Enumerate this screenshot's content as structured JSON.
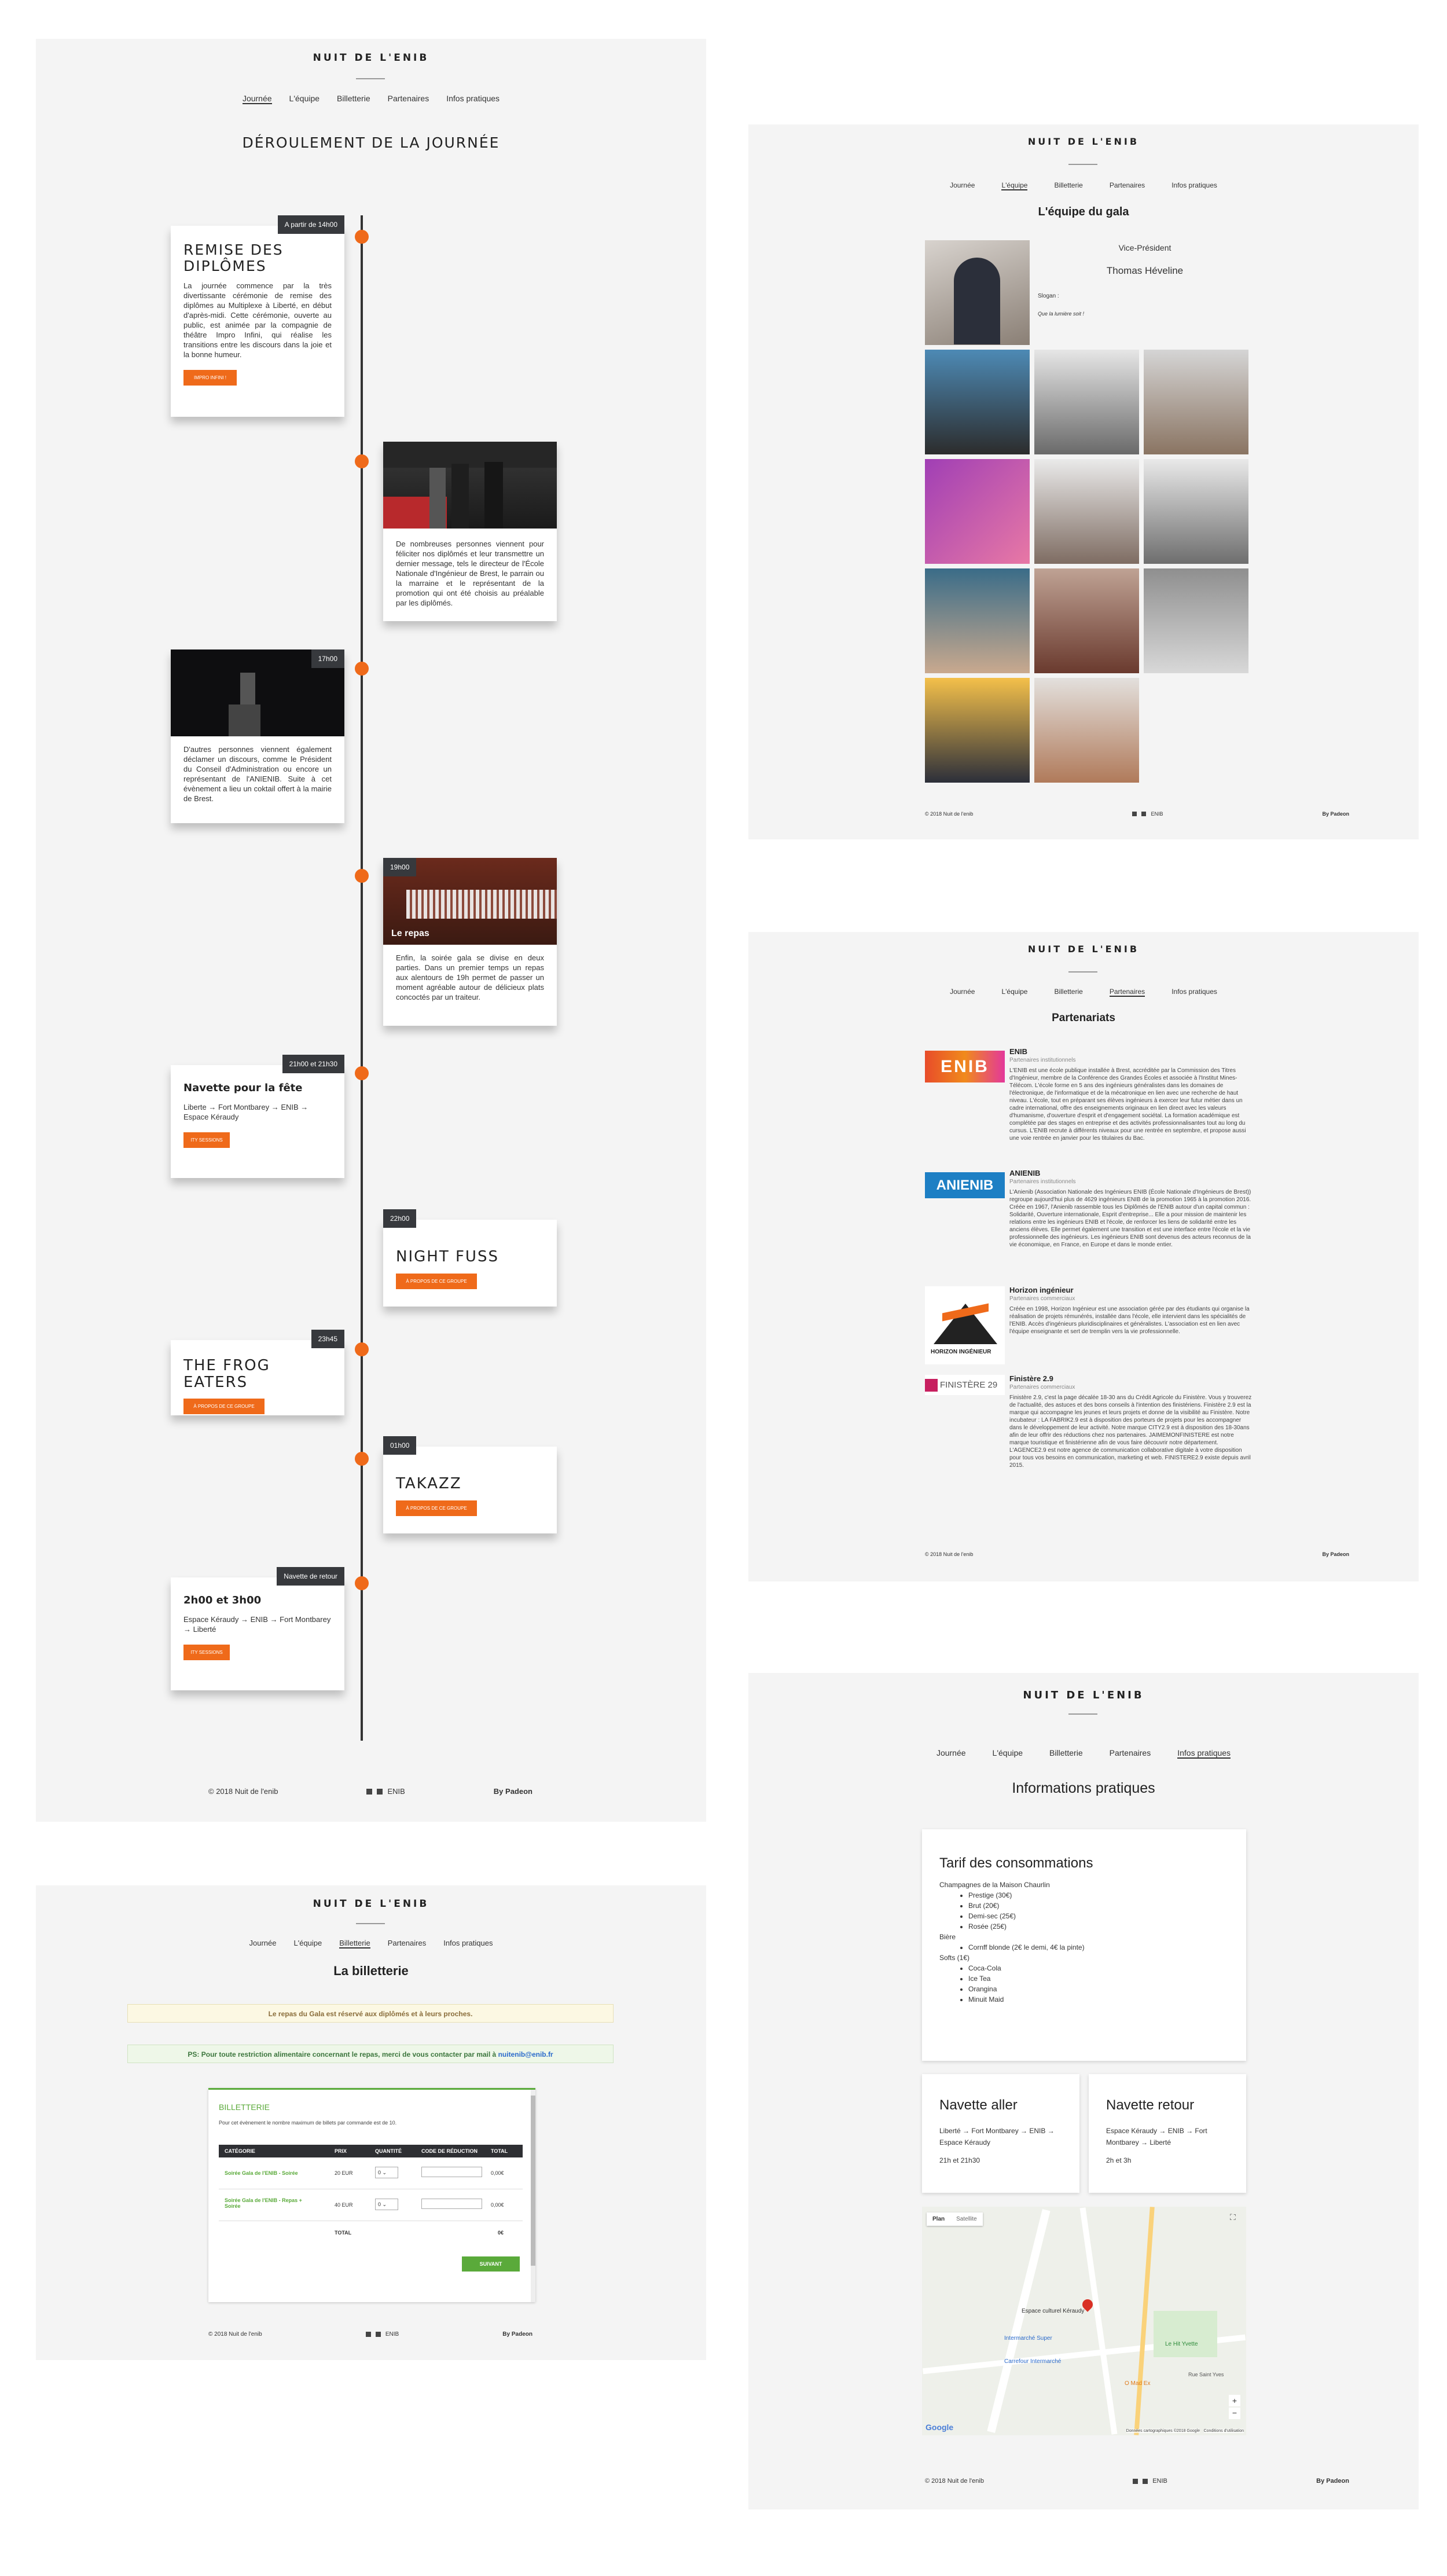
{
  "brand": "NUIT DE L'ENIB",
  "nav": [
    "Journée",
    "L'équipe",
    "Billetterie",
    "Partenaires",
    "Infos pratiques"
  ],
  "footer": {
    "copyright": "©  2018 Nuit de l'enib",
    "link": "ENIB",
    "by": "By Padeon"
  },
  "journee": {
    "title": "DÉROULEMENT DE LA JOURNÉE",
    "events": [
      {
        "badge": "A partir de 14h00",
        "title": "REMISE DES DIPLÔMES",
        "text": "La journée commence par la très divertissante cérémonie de remise des diplômes au Multiplexe à Liberté, en début d'après-midi. Cette cérémonie, ouverte au public, est animée par la compagnie de théâtre Impro Infini, qui réalise les transitions entre les discours dans la joie et la bonne humeur.",
        "button": "IMPRO INFINI !"
      },
      {
        "badge": "",
        "title": "",
        "text": "De nombreuses personnes viennent pour féliciter nos diplômés et leur transmettre un dernier message, tels le directeur de l'École Nationale d'Ingénieur de Brest, le parrain ou la marraine et le représentant de la promotion qui ont été choisis au préalable par les diplômés.",
        "button": ""
      },
      {
        "badge": "17h00",
        "title": "",
        "text": "D'autres personnes viennent également déclamer un discours, comme le Président du Conseil d'Administration ou encore un représentant de l'ANIENIB. Suite à cet évènement a lieu un coktail offert à la mairie de Brest.",
        "button": ""
      },
      {
        "badge": "19h00",
        "title": "",
        "caption": "Le repas",
        "text": "Enfin, la soirée gala se divise en deux parties. Dans un premier temps un repas aux alentours de 19h permet de passer un moment agréable autour de délicieux plats concoctés par un traiteur.",
        "button": ""
      },
      {
        "badge": "21h00 et 21h30",
        "title": "Navette pour la fête",
        "text": "Liberte → Fort Montbarey → ENIB → Espace Kéraudy",
        "button": "ITY SESSIONS"
      },
      {
        "badge": "22h00",
        "title": "NIGHT FUSS",
        "text": "",
        "button": "À PROPOS DE CE GROUPE"
      },
      {
        "badge": "23h45",
        "title": "THE FROG EATERS",
        "text": "",
        "button": "À PROPOS DE CE GROUPE"
      },
      {
        "badge": "01h00",
        "title": "TAKAZZ",
        "text": "",
        "button": "À PROPOS DE CE GROUPE"
      },
      {
        "badge": "Navette de retour",
        "title": "2h00 et 3h00",
        "text": "Espace Kéraudy → ENIB → Fort Montbarey → Liberté",
        "button": "ITY SESSIONS"
      }
    ]
  },
  "billetterie": {
    "title": "La billetterie",
    "notice1": "Le repas du Gala est réservé aux diplômés et à leurs proches.",
    "notice2_prefix": "PS: Pour toute restriction alimentaire concernant le repas, merci de vous contacter par mail à ",
    "notice2_email": "nuitenib@enib.fr",
    "widget_title": "BILLETTERIE",
    "widget_note": "Pour cet évènement le nombre maximum de billets par commande est de 10.",
    "headers": [
      "CATÉGORIE",
      "PRIX",
      "QUANTITÉ",
      "CODE DE RÉDUCTION",
      "TOTAL"
    ],
    "rows": [
      {
        "cat": "Soirée Gala de l'ENIB - Soirée",
        "price": "20 EUR",
        "qty": "0",
        "total": "0,00€"
      },
      {
        "cat": "Soirée Gala de l'ENIB - Repas + Soirée",
        "price": "40 EUR",
        "qty": "0",
        "total": "0,00€"
      }
    ],
    "total_label": "TOTAL",
    "total_value": "0€",
    "submit": "SUIVANT"
  },
  "equipe": {
    "title": "L'équipe du gala",
    "role": "Vice-Président",
    "name": "Thomas Héveline",
    "slogan": "Slogan :",
    "quote": "Que la lumière soit !"
  },
  "partenaires": {
    "title": "Partenariats",
    "items": [
      {
        "logo": "ENIB",
        "name": "ENIB",
        "sub": "Partenaires institutionnels",
        "text": "L'ENIB est une école publique installée à Brest, accréditée par la Commission des Titres d'Ingénieur, membre de la Conférence des Grandes Écoles et associée à l'Institut Mines-Télécom. L'école forme en 5 ans des ingénieurs généralistes dans les domaines de l'électronique, de l'informatique et de la mécatronique en lien avec une recherche de haut niveau. L'école, tout en préparant ses élèves ingénieurs à exercer leur futur métier dans un cadre international, offre des enseignements originaux en lien direct avec les valeurs d'humanisme, d'ouverture d'esprit et d'engagement sociétal. La formation académique est complétée par des stages en entreprise et des activités professionnalisantes tout au long du cursus. L'ENIB recrute à différents niveaux pour une rentrée en septembre, et propose aussi une voie rentrée en janvier pour les titulaires du Bac."
      },
      {
        "logo": "ANIENIB",
        "name": "ANIENIB",
        "sub": "Partenaires institutionnels",
        "text": "L'Anienib (Association Nationale des Ingénieurs ENIB (École Nationale d'Ingénieurs de Brest)) regroupe aujourd'hui plus de 4629 ingénieurs ENIB de la promotion 1965 à la promotion 2016. Créée en 1967, l'Anienib rassemble tous les Diplômés de l'ENIB autour d'un capital commun : Solidarité, Ouverture internationale, Esprit d'entreprise... Elle a pour mission de maintenir les relations entre les ingénieurs ENIB et l'école, de renforcer les liens de solidarité entre les anciens élèves. Elle permet également une transition et est une interface entre l'école et la vie professionnelle des ingénieurs. Les ingénieurs ENIB sont devenus des acteurs reconnus de la vie économique, en France, en Europe et dans le monde entier."
      },
      {
        "logo": "HORIZON INGÉNIEUR",
        "name": "Horizon ingénieur",
        "sub": "Partenaires commerciaux",
        "text": "Créée en 1998, Horizon Ingénieur est une association gérée par des étudiants qui organise la réalisation de projets rémunérés, installée dans l'école, elle intervient dans les spécialités de l'ENIB. Accès d'ingénieurs pluridisciplinaires et généralistes. L'association est en lien avec l'équipe enseignante et sert de tremplin vers la vie professionnelle."
      },
      {
        "logo": "FINISTÈRE 29",
        "name": "Finistère 2.9",
        "sub": "Partenaires commerciaux",
        "text": "Finistère 2.9, c'est la page décalée 18-30 ans du Crédit Agricole du Finistère. Vous y trouverez de l'actualité, des astuces et des bons conseils à l'intention des finistériens. Finistère 2.9 est la marque qui accompagne les jeunes et leurs projets et donne de la visibilité au Finistère. Notre incubateur : LA FABRIK2.9 est à disposition des porteurs de projets pour les accompagner dans le développement de leur activité. Notre marque CITY2.9 est à disposition des 18-30ans afin de leur offrir des réductions chez nos partenaires. JAIMEMONFINISTERE est notre marque touristique et finistérienne afin de vous faire découvrir notre département. L'AGENCE2.9 est notre agence de communication collaborative digitale à votre disposition pour tous vos besoins en communication, marketing et web. FINISTERE2.9 existe depuis avril 2015."
      }
    ]
  },
  "infos": {
    "title": "Informations pratiques",
    "tarif_title": "Tarif des consommations",
    "tarif": [
      {
        "label": "Champagnes de la Maison Chaurlin",
        "sub": [
          "Prestige (30€)",
          "Brut (20€)",
          "Demi-sec (25€)",
          "Rosée (25€)"
        ]
      },
      {
        "label": "Bière",
        "sub": [
          "Cornff blonde (2€ le demi, 4€ la pinte)"
        ]
      },
      {
        "label": "Softs (1€)",
        "sub": [
          "Coca-Cola",
          "Ice Tea",
          "Orangina",
          "Minuit Maid"
        ]
      }
    ],
    "aller_title": "Navette aller",
    "aller_text": "Liberté → Fort Montbarey → ENIB → Espace Kéraudy",
    "aller_time": "21h et 21h30",
    "retour_title": "Navette retour",
    "retour_text": "Espace Kéraudy → ENIB → Fort Montbarey → Liberté",
    "retour_time": "2h et 3h",
    "map_plan": "Plan",
    "map_sat": "Satellite",
    "map_labels": [
      "Espace culturel Kéraudy",
      "Intermarché Super",
      "Carrefour Intermarché",
      "Le Hit Yvette",
      "O Mad Ex",
      "Rue Saint Yves",
      "Google",
      "Données cartographiques ©2018 Google",
      "Conditions d'utilisation"
    ]
  }
}
